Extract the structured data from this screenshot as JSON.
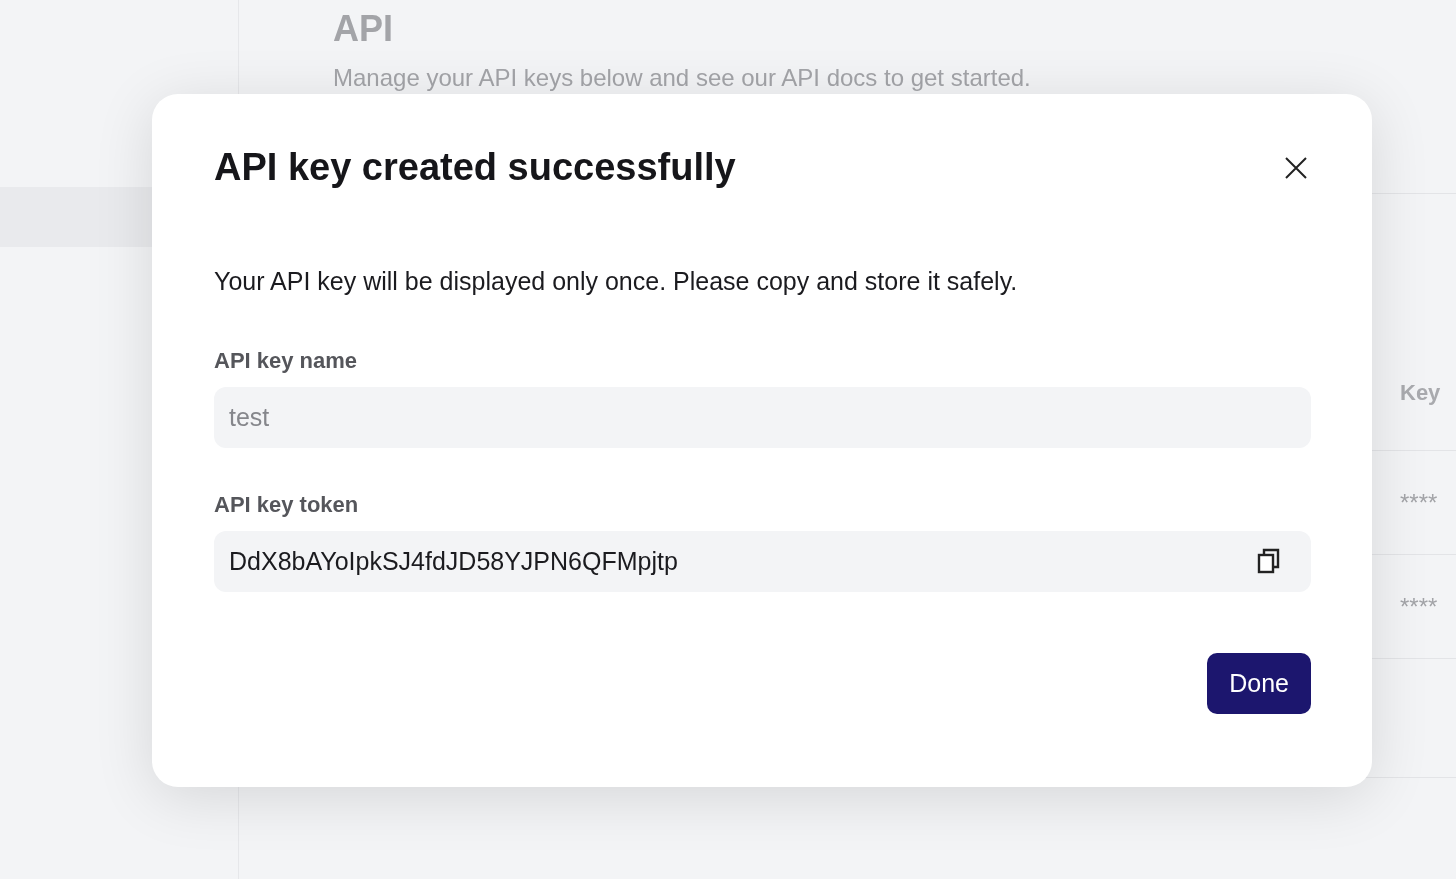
{
  "page": {
    "title": "API",
    "subtitle": "Manage your API keys below and see our API docs to get started.",
    "table": {
      "columns": [
        "Key"
      ],
      "rows": [
        {
          "key": "****"
        },
        {
          "key": "****"
        }
      ]
    }
  },
  "dialog": {
    "title": "API key created successfully",
    "message": "Your API key will be displayed only once. Please copy and store it safely.",
    "fields": [
      {
        "label": "API key name",
        "value": "test",
        "disabled": true,
        "kind": "text"
      },
      {
        "label": "API key token",
        "value": "DdX8bAYoIpkSJ4fdJD58YJPN6QFMpjtp",
        "disabled": false,
        "kind": "copy"
      }
    ],
    "buttons": [
      "Done"
    ]
  }
}
